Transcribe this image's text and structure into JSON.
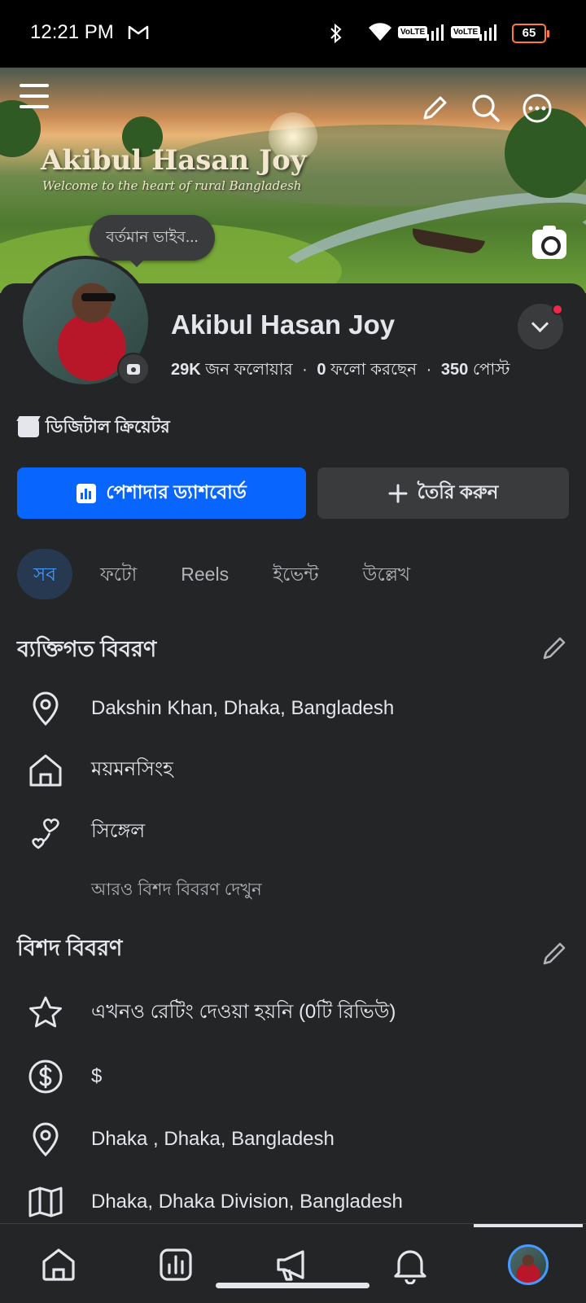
{
  "status_bar": {
    "time": "12:21 PM",
    "volte_1": "VoLTE",
    "volte_2": "VoLTE",
    "battery": "65",
    "icons": [
      "gmail-icon",
      "bluetooth-icon",
      "wifi-icon",
      "signal-icon",
      "signal-icon",
      "battery-icon"
    ]
  },
  "cover": {
    "title": "Akibul Hasan Joy",
    "subtitle": "Welcome to the heart of rural Bangladesh"
  },
  "vibe_bubble": "বর্তমান ভাইব...",
  "profile": {
    "name": "Akibul Hasan Joy",
    "followers_count": "29K",
    "followers_label": "জন ফলোয়ার",
    "following_count": "0",
    "following_label": "ফলো করছেন",
    "posts_count": "350",
    "posts_label": "পোস্ট",
    "category": "ডিজিটাল ক্রিয়েটর"
  },
  "actions": {
    "dashboard_label": "পেশাদার ড্যাশবোর্ড",
    "create_label": "তৈরি করুন"
  },
  "tabs": [
    {
      "label": "সব",
      "active": true
    },
    {
      "label": "ফটো",
      "active": false
    },
    {
      "label": "Reels",
      "active": false
    },
    {
      "label": "ইভেন্ট",
      "active": false
    },
    {
      "label": "উল্লেখ",
      "active": false
    }
  ],
  "personal_details": {
    "title": "ব্যক্তিগত বিবরণ",
    "items": [
      {
        "icon": "location-pin-icon",
        "text": "Dakshin Khan, Dhaka, Bangladesh"
      },
      {
        "icon": "home-icon",
        "text": "ময়মনসিংহ"
      },
      {
        "icon": "relationship-hearts-icon",
        "text": "সিঙ্গেল"
      }
    ],
    "see_more": "আরও বিশদ বিবরণ দেখুন"
  },
  "details": {
    "title": "বিশদ বিবরণ",
    "items": [
      {
        "icon": "star-icon",
        "text": "এখনও রেটিং দেওয়া হয়নি (0টি রিভিউ)"
      },
      {
        "icon": "dollar-icon",
        "text": "$"
      },
      {
        "icon": "location-pin-icon",
        "text": "Dhaka , Dhaka, Bangladesh"
      },
      {
        "icon": "map-icon",
        "text": "Dhaka, Dhaka Division, Bangladesh"
      }
    ]
  },
  "bottom_nav": [
    "home-icon",
    "dashboard-icon",
    "megaphone-icon",
    "bell-icon",
    "profile-avatar"
  ],
  "colors": {
    "background": "#242527",
    "primary": "#0866ff",
    "tab_active_bg": "#263951",
    "tab_active_text": "#4599ff",
    "notification": "#f02849"
  }
}
